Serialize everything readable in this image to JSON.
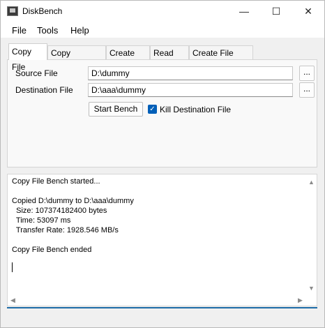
{
  "window": {
    "title": "DiskBench",
    "minimize": "—",
    "maximize": "☐",
    "close": "✕"
  },
  "menu": [
    "File",
    "Tools",
    "Help"
  ],
  "tabs": [
    "Copy File",
    "Copy Directory",
    "Create File",
    "Read File",
    "Create File Batch"
  ],
  "form": {
    "source_label": "Source File",
    "source_value": "D:\\dummy",
    "destination_label": "Destination File",
    "destination_value": "D:\\aaa\\dummy",
    "browse": "...",
    "start_button": "Start Bench",
    "kill_label": "Kill Destination File",
    "kill_checked": true
  },
  "log": [
    "Copy File Bench started...",
    "",
    "Copied D:\\dummy to D:\\aaa\\dummy",
    "  Size: 107374182400 bytes",
    "  Time: 53097 ms",
    "  Transfer Rate: 1928.546 MB/s",
    "",
    "Copy File Bench ended"
  ],
  "icons": {
    "scroll_up": "▲",
    "scroll_down": "▼",
    "scroll_left": "◀",
    "scroll_right": "▶",
    "check": "✓"
  },
  "colors": {
    "accent": "#005fb8",
    "status_bar": "#1c6aa6"
  }
}
